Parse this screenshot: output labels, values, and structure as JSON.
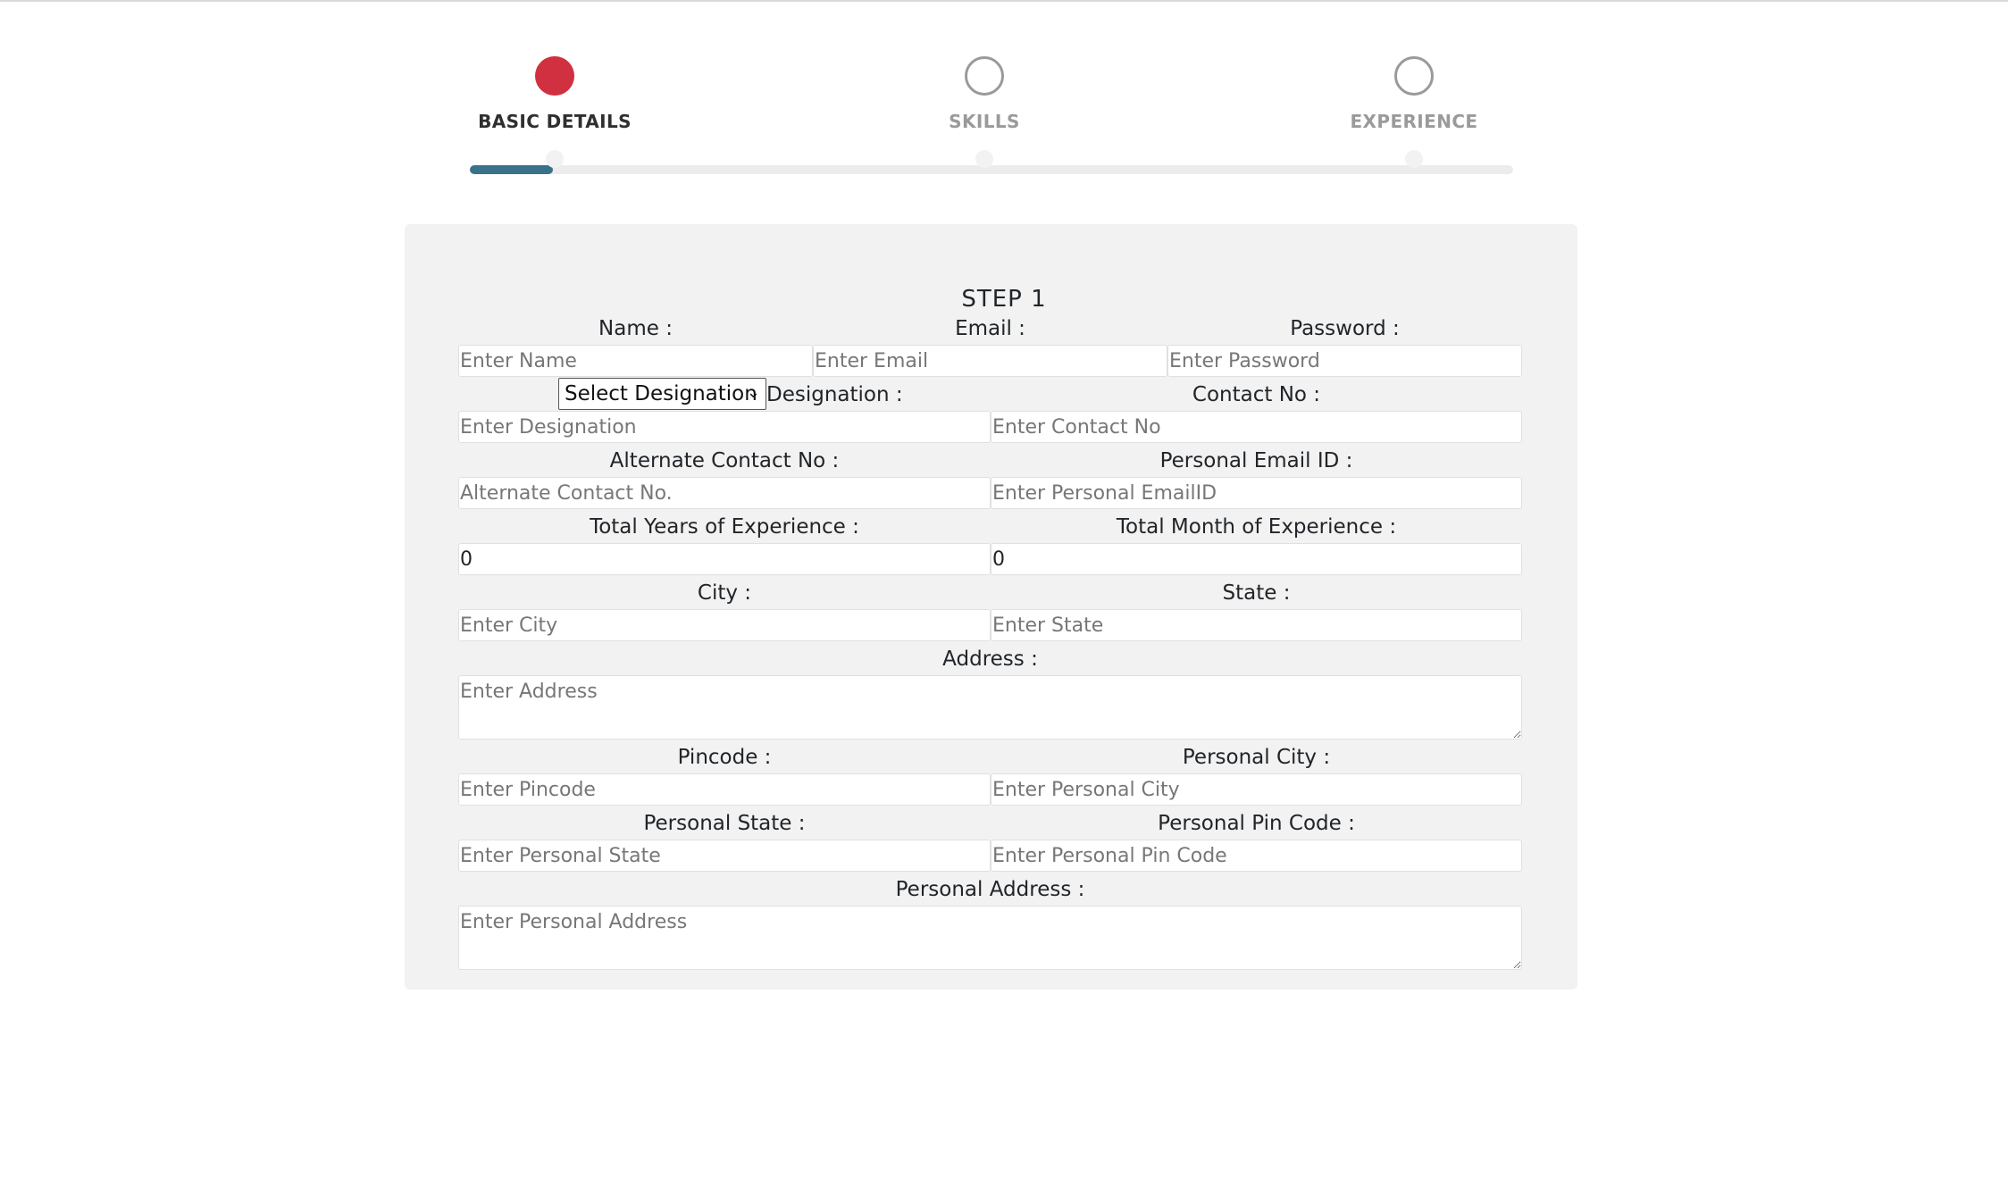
{
  "stepper": {
    "steps": [
      {
        "label": "BASIC DETAILS",
        "state": "active"
      },
      {
        "label": "SKILLS",
        "state": "inactive"
      },
      {
        "label": "EXPERIENCE",
        "state": "inactive"
      }
    ],
    "progress_fraction": 0.08,
    "colors": {
      "active": "#d0303f",
      "inactive": "#9a9a9a",
      "progress": "#3a7389"
    }
  },
  "form": {
    "title": "STEP 1",
    "name": {
      "label": "Name :",
      "placeholder": "Enter Name"
    },
    "email": {
      "label": "Email :",
      "placeholder": "Enter Email"
    },
    "password": {
      "label": "Password :",
      "placeholder": "Enter Password"
    },
    "designation_select": {
      "selected": "Select Designation"
    },
    "designation": {
      "label": "Designation :",
      "placeholder": "Enter Designation"
    },
    "contact": {
      "label": "Contact No :",
      "placeholder": "Enter Contact No"
    },
    "alt_contact": {
      "label": "Alternate Contact No :",
      "placeholder": "Alternate Contact No."
    },
    "personal_email": {
      "label": "Personal Email ID :",
      "placeholder": "Enter Personal EmailID"
    },
    "years_exp": {
      "label": "Total Years of Experience :",
      "value": "0"
    },
    "months_exp": {
      "label": "Total Month of Experience :",
      "value": "0"
    },
    "city": {
      "label": "City :",
      "placeholder": "Enter City"
    },
    "state": {
      "label": "State :",
      "placeholder": "Enter State"
    },
    "address": {
      "label": "Address :",
      "placeholder": "Enter Address"
    },
    "pincode": {
      "label": "Pincode :",
      "placeholder": "Enter Pincode"
    },
    "personal_city": {
      "label": "Personal City :",
      "placeholder": "Enter Personal City"
    },
    "personal_state": {
      "label": "Personal State :",
      "placeholder": "Enter Personal State"
    },
    "personal_pin": {
      "label": "Personal Pin Code :",
      "placeholder": "Enter Personal Pin Code"
    },
    "personal_address": {
      "label": "Personal Address :",
      "placeholder": "Enter Personal Address"
    }
  }
}
